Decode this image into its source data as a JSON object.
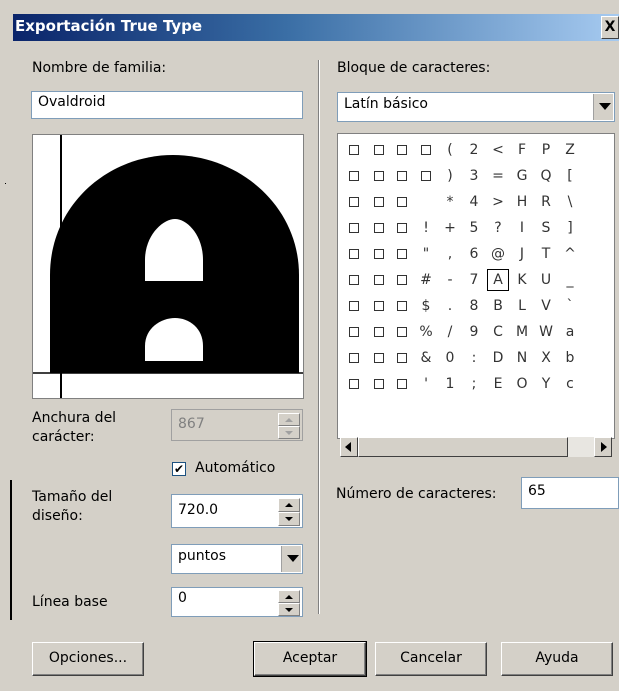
{
  "window": {
    "title": "Exportación True Type",
    "close_label": "X"
  },
  "left": {
    "family_label": "Nombre de familia:",
    "family_value": "Ovaldroid",
    "width_label": "Anchura del carácter:",
    "width_value": "867",
    "auto_label": "Automático",
    "auto_checked": true,
    "design_size_label": "Tamaño del diseño:",
    "design_size_value": "720.0",
    "units_value": "puntos",
    "baseline_label": "Línea base",
    "baseline_value": "0"
  },
  "right": {
    "block_label": "Bloque de caracteres:",
    "block_value": "Latín básico",
    "char_count_label": "Número de caracteres:",
    "char_count_value": "65",
    "selected_char": "A",
    "columns": [
      [
        "□",
        "□",
        "□",
        "□",
        "□",
        "□",
        "□",
        "□",
        "□",
        "□"
      ],
      [
        "□",
        "□",
        "□",
        "□",
        "□",
        "□",
        "□",
        "□",
        "□",
        "□"
      ],
      [
        "□",
        "□",
        "□",
        "□",
        "□",
        "□",
        "□",
        "□",
        "□",
        "□"
      ],
      [
        "□",
        "□",
        "",
        "!",
        "\"",
        "#",
        "$",
        "%",
        "&",
        "'"
      ],
      [
        "(",
        ")",
        "*",
        "+",
        ",",
        "-",
        ".",
        "/",
        "0",
        "1"
      ],
      [
        "2",
        "3",
        "4",
        "5",
        "6",
        "7",
        "8",
        "9",
        ":",
        ";"
      ],
      [
        "<",
        "=",
        ">",
        "?",
        "@",
        "A",
        "B",
        "C",
        "D",
        "E"
      ],
      [
        "F",
        "G",
        "H",
        "I",
        "J",
        "K",
        "L",
        "M",
        "N",
        "O"
      ],
      [
        "P",
        "Q",
        "R",
        "S",
        "T",
        "U",
        "V",
        "W",
        "X",
        "Y"
      ],
      [
        "Z",
        "[",
        "\\",
        "]",
        "^",
        "_",
        "`",
        "a",
        "b",
        "c"
      ]
    ]
  },
  "buttons": {
    "options": "Opciones...",
    "ok": "Aceptar",
    "cancel": "Cancelar",
    "help": "Ayuda"
  }
}
